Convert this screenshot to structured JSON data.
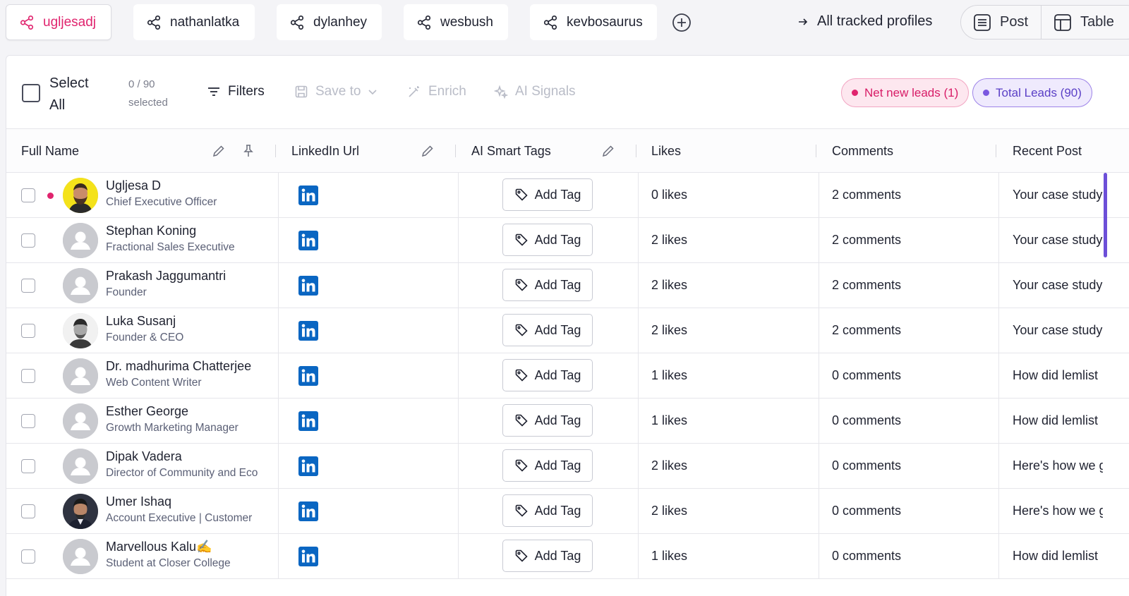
{
  "profiles": [
    {
      "label": "ugljesadj",
      "active": true
    },
    {
      "label": "nathanlatka",
      "active": false
    },
    {
      "label": "dylanhey",
      "active": false
    },
    {
      "label": "wesbush",
      "active": false
    },
    {
      "label": "kevbosaurus",
      "active": false
    }
  ],
  "all_tracked_label": "All tracked profiles",
  "views": {
    "post_label": "Post",
    "table_label": "Table"
  },
  "toolbar": {
    "select_all_label": "Select All",
    "selected_count": "0 / 90",
    "selected_label": "selected",
    "filters_label": "Filters",
    "save_to_label": "Save to",
    "enrich_label": "Enrich",
    "ai_signals_label": "AI Signals",
    "net_new_label": "Net new leads (1)",
    "total_leads_label": "Total Leads (90)"
  },
  "columns": {
    "full_name": "Full Name",
    "linkedin": "LinkedIn Url",
    "tags": "AI Smart Tags",
    "likes": "Likes",
    "comments": "Comments",
    "recent_post": "Recent Post"
  },
  "add_tag_label": "Add Tag",
  "rows": [
    {
      "name": "Ugljesa D",
      "title": "Chief Executive Officer",
      "likes": "0 likes",
      "comments": "2 comments",
      "recent_post": "Your case study",
      "new": true,
      "avatar": "photo-yellow"
    },
    {
      "name": "Stephan Koning",
      "title": "Fractional Sales Executive",
      "likes": "2 likes",
      "comments": "2 comments",
      "recent_post": "Your case study",
      "new": false,
      "avatar": "placeholder"
    },
    {
      "name": "Prakash Jaggumantri",
      "title": "Founder",
      "likes": "2 likes",
      "comments": "2 comments",
      "recent_post": "Your case study",
      "new": false,
      "avatar": "placeholder"
    },
    {
      "name": "Luka Susanj",
      "title": "Founder & CEO",
      "likes": "2 likes",
      "comments": "2 comments",
      "recent_post": "Your case study",
      "new": false,
      "avatar": "photo-bw"
    },
    {
      "name": "Dr. madhurima Chatterjee",
      "title": "Web Content Writer",
      "likes": "1 likes",
      "comments": "0 comments",
      "recent_post": "How did lemlist",
      "new": false,
      "avatar": "placeholder"
    },
    {
      "name": "Esther George",
      "title": "Growth Marketing Manager",
      "likes": "1 likes",
      "comments": "0 comments",
      "recent_post": "How did lemlist",
      "new": false,
      "avatar": "placeholder"
    },
    {
      "name": "Dipak Vadera",
      "title": "Director of Community and Eco",
      "likes": "2 likes",
      "comments": "0 comments",
      "recent_post": "Here's how we g",
      "new": false,
      "avatar": "placeholder"
    },
    {
      "name": "Umer Ishaq",
      "title": "Account Executive | Customer",
      "likes": "2 likes",
      "comments": "0 comments",
      "recent_post": "Here's how we g",
      "new": false,
      "avatar": "photo-suit"
    },
    {
      "name": "Marvellous Kalu✍️",
      "title": "Student at Closer College",
      "likes": "1 likes",
      "comments": "0 comments",
      "recent_post": "How did lemlist",
      "new": false,
      "avatar": "placeholder"
    }
  ],
  "colors": {
    "brand_pink": "#e0246e",
    "brand_purple": "#6c4fd8",
    "linkedin_blue": "#0a66c2"
  }
}
